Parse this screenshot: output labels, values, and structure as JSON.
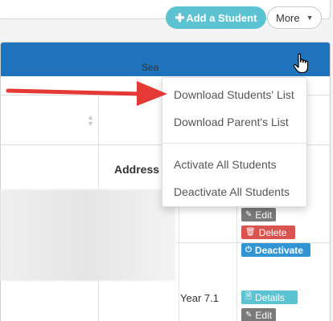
{
  "header": {
    "add_student_label": "Add a Student",
    "more_label": "More"
  },
  "search": {
    "label": "Sea"
  },
  "table": {
    "address_header": "Address",
    "rows": [
      {
        "year": "",
        "actions": {
          "edit": "Edit",
          "delete": "Delete",
          "deactivate": "Deactivate"
        }
      },
      {
        "year": "Year 7.1",
        "actions": {
          "details": "Details",
          "edit": "Edit"
        }
      }
    ]
  },
  "dropdown": {
    "items": [
      {
        "label": "Download Students' List"
      },
      {
        "label": "Download Parent's List"
      },
      {
        "label": "Activate All Students"
      },
      {
        "label": "Deactivate All Students"
      }
    ]
  },
  "colors": {
    "header_bg": "#1f73bd",
    "add_button": "#5bc3d2",
    "delete_button": "#d9534f",
    "deactivate_button": "#3195d3",
    "arrow": "#e53935"
  },
  "icons": [
    "plus-icon",
    "chevron-down-icon",
    "hand-cursor-icon",
    "sort-icon",
    "pencil-icon",
    "trash-icon",
    "power-icon",
    "document-icon"
  ]
}
